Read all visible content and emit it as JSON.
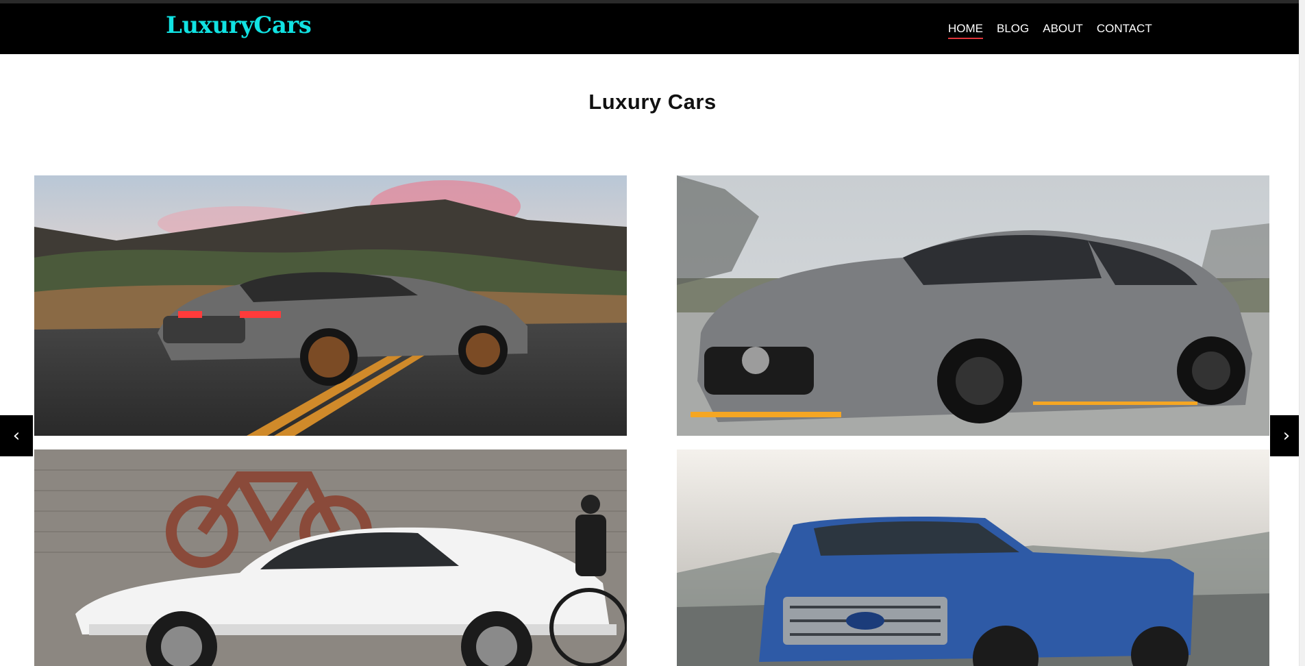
{
  "header": {
    "logo": "LuxuryCars",
    "nav": [
      {
        "label": "HOME",
        "active": true
      },
      {
        "label": "BLOG",
        "active": false
      },
      {
        "label": "ABOUT",
        "active": false
      },
      {
        "label": "CONTACT",
        "active": false
      }
    ],
    "accent_color": "#11e2e2",
    "active_underline_color": "#e2353a"
  },
  "main": {
    "title": "Luxury Cars"
  },
  "gallery": {
    "images": [
      {
        "name": "grey-sports-car-on-mountain-road"
      },
      {
        "name": "grey-sports-coupe-front-view"
      },
      {
        "name": "white-sedan-with-cyclist"
      },
      {
        "name": "blue-pickup-truck"
      }
    ],
    "prev_icon": "‹",
    "next_icon": "›"
  }
}
